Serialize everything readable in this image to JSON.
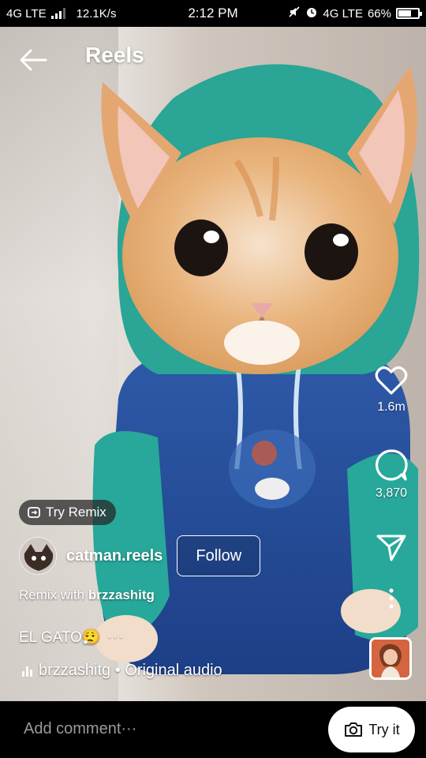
{
  "status_bar": {
    "network_left": "4G LTE",
    "speed": "12.1K/s",
    "time": "2:12 PM",
    "network_right": "4G LTE",
    "battery": "66%",
    "battery_level": 0.66
  },
  "header": {
    "title": "Reels",
    "back_icon": "arrow-left-icon"
  },
  "actions": {
    "like_count": "1.6m",
    "comment_count": "3,870",
    "like_icon": "heart-icon",
    "comment_icon": "comment-bubble-icon",
    "share_icon": "paper-plane-icon",
    "more_icon": "vertical-dots-icon"
  },
  "post": {
    "try_remix_label": "Try Remix",
    "username": "catman.reels",
    "follow_label": "Follow",
    "remix_prefix": "Remix with",
    "remix_user": "brzzashitg",
    "caption": "EL GATO😮‍💨",
    "caption_more": "···",
    "audio_text": "brzzashitg • Original audio"
  },
  "comment_bar": {
    "placeholder": "Add comment···",
    "try_it_label": "Try it"
  }
}
